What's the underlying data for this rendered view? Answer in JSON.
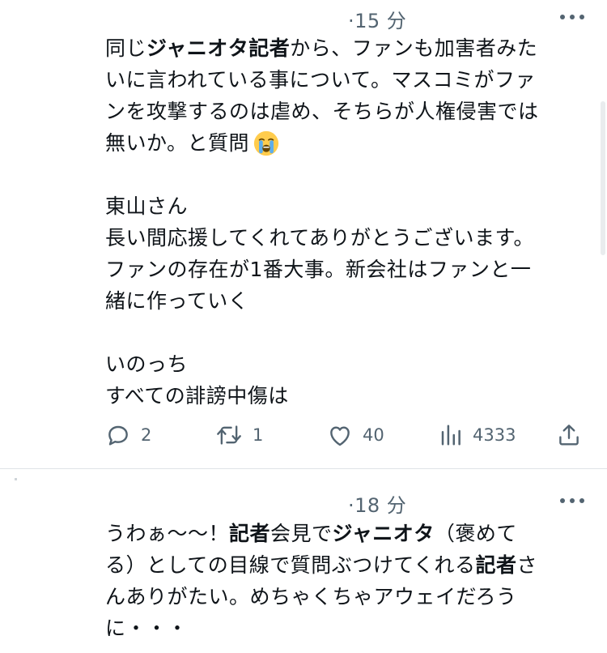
{
  "tweets": [
    {
      "time": "·15 分",
      "lines": [
        [
          {
            "t": "同じ"
          },
          {
            "t": "ジャニオタ記者",
            "b": true
          },
          {
            "t": "から、ファンも加害者みた"
          }
        ],
        [
          {
            "t": "いに言われている事について。マスコミがファ"
          }
        ],
        [
          {
            "t": "ンを攻撃するのは虐め、そちらが人権侵害では"
          }
        ],
        [
          {
            "t": "無いか。と質問"
          }
        ],
        [],
        [
          {
            "t": "東山さん"
          }
        ],
        [
          {
            "t": "長い間応援してくれてありがとうございます。"
          }
        ],
        [
          {
            "t": "ファンの存在が1番大事。新会社はファンと一"
          }
        ],
        [
          {
            "t": "緒に作っていく"
          }
        ],
        [],
        [
          {
            "t": "いのっち"
          }
        ],
        [
          {
            "t": "すべての誹謗中傷は"
          }
        ]
      ],
      "emoji": "loudly-crying-face",
      "actions": {
        "reply": "2",
        "retweet": "1",
        "like": "40",
        "views": "4333"
      }
    },
    {
      "time": "·18 分",
      "lines": [
        [
          {
            "t": "うわぁ〜〜！"
          },
          {
            "t": "記者",
            "b": true
          },
          {
            "t": "会見で"
          },
          {
            "t": "ジャニオタ",
            "b": true
          },
          {
            "t": "（褒めて"
          }
        ],
        [
          {
            "t": "る）としての目線で質問ぶつけてくれる"
          },
          {
            "t": "記者",
            "b": true
          },
          {
            "t": "さ"
          }
        ],
        [
          {
            "t": "んありがたい。めちゃくちゃアウェイだろう"
          }
        ],
        [
          {
            "t": "に・・・"
          }
        ]
      ]
    }
  ],
  "colors": {
    "text": "#0f1419",
    "secondary": "#536471",
    "divider": "#dfe3e7",
    "emoji_face": "#ffcc4d",
    "emoji_tears": "#5dadec"
  },
  "icons": [
    "reply-icon",
    "retweet-icon",
    "like-icon",
    "views-icon",
    "share-icon",
    "more-icon"
  ]
}
